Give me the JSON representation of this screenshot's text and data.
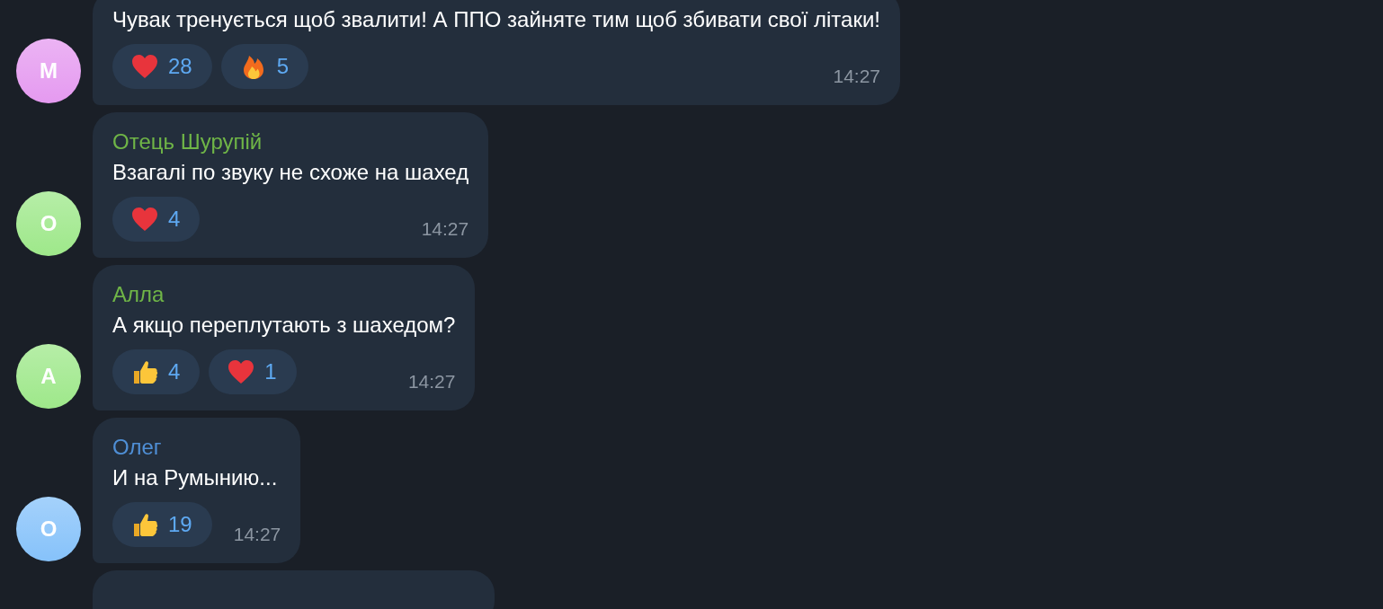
{
  "messages": [
    {
      "avatar": {
        "letter": "M",
        "color": "#e59af0"
      },
      "text": "Чувак тренується щоб звалити! А ППО зайняте тим щоб збивати свої літаки!",
      "reactions": [
        {
          "kind": "heart",
          "count": "28"
        },
        {
          "kind": "fire",
          "count": "5"
        }
      ],
      "time": "14:27"
    },
    {
      "avatar": {
        "letter": "O",
        "color": "#9ee88a"
      },
      "author": {
        "name": "Отець Шурупій",
        "color": "#6fb547"
      },
      "text": "Взагалі по звуку не схоже на шахед",
      "reactions": [
        {
          "kind": "heart",
          "count": "4"
        }
      ],
      "time": "14:27"
    },
    {
      "avatar": {
        "letter": "A",
        "color": "#9ee88a"
      },
      "author": {
        "name": "Алла",
        "color": "#6fb547"
      },
      "text": "А якщо переплутають з шахедом?",
      "reactions": [
        {
          "kind": "thumb",
          "count": "4"
        },
        {
          "kind": "heart",
          "count": "1"
        }
      ],
      "time": "14:27"
    },
    {
      "avatar": {
        "letter": "O",
        "color": "#86c2fa"
      },
      "author": {
        "name": "Олег",
        "color": "#4f8fd6"
      },
      "text": "И на Румынию...",
      "reactions": [
        {
          "kind": "thumb",
          "count": "19"
        }
      ],
      "time": "14:27"
    }
  ]
}
